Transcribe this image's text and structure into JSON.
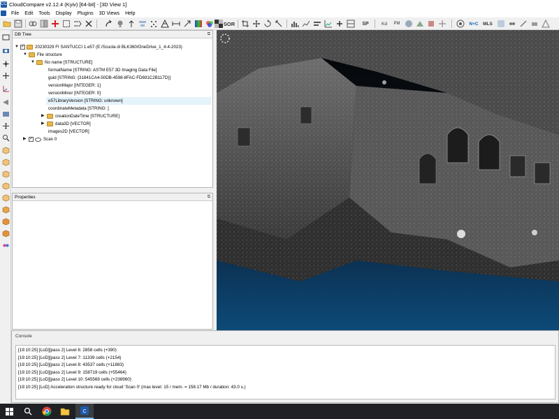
{
  "window": {
    "title": "CloudCompare v2.12.4 (Kyiv) [64-bit] - [3D View 1]"
  },
  "menu": {
    "items": [
      "File",
      "Edit",
      "Tools",
      "Display",
      "Plugins",
      "3D Views",
      "Help"
    ]
  },
  "toolbar": {
    "labels": {
      "sor": "SOR",
      "sp": "SP",
      "kd": "Kd",
      "pm": "PM",
      "nc": "N+C",
      "mls": "MLS"
    }
  },
  "db_tree": {
    "title": "DB Tree",
    "nodes": [
      {
        "label": "20230329 FI SANTUCCI 1.e57 (E:/Scuola di BLK360/OneDrive_1_4-4-2023)",
        "type": "folder",
        "expanded": true,
        "checked": true
      },
      {
        "label": "File structure",
        "type": "folder",
        "expanded": true
      },
      {
        "label": "No name [STRUCTURE]",
        "type": "folder",
        "expanded": true
      },
      {
        "label": "formatName [STRING: ASTM E57 3D Imaging Data File]",
        "type": "leaf"
      },
      {
        "label": "guid [STRING: {31841CA4-50DB-4598-8FAC-FD691C2B117D}]",
        "type": "leaf"
      },
      {
        "label": "versionMajor [INTEGER: 1]",
        "type": "leaf"
      },
      {
        "label": "versionMinor [INTEGER: 0]",
        "type": "leaf"
      },
      {
        "label": "e57LibraryVersion [STRING: unknown]",
        "type": "leaf",
        "selected": true
      },
      {
        "label": "coordinateMetadata [STRING: ]",
        "type": "leaf"
      },
      {
        "label": "creationDateTime [STRUCTURE]",
        "type": "folder",
        "expanded": false
      },
      {
        "label": "data3D [VECTOR]",
        "type": "folder",
        "expanded": false
      },
      {
        "label": "images2D [VECTOR]",
        "type": "leaf"
      },
      {
        "label": "Scan 0",
        "type": "cloud",
        "expanded": false,
        "checked": true
      }
    ]
  },
  "properties": {
    "title": "Properties"
  },
  "console": {
    "title": "Console",
    "lines": [
      "[19:10:25] [LoD][pass 2] Level 6: 2858 cells (+390)",
      "[19:10:25] [LoD][pass 2] Level 7: 11339 cells (+2154)",
      "[19:10:25] [LoD][pass 2] Level 8: 43537 cells (+11883)",
      "[19:10:25] [LoD][pass 2] Level 9: 158719 cells (+55464)",
      "[19:10:25] [LoD][pass 2] Level 10: 545569 cells (+238960)",
      "[19:10:25] [LoD] Acceleration structure ready for cloud 'Scan 0' (max level: 15 / mem. = 158.17 Mb / duration: 43.0 s.)"
    ]
  },
  "colors": {
    "accent": "#0078d7",
    "folder": "#e8b84a",
    "viewport_bottom": "#0d4a78",
    "taskbar": "#1f2124"
  }
}
